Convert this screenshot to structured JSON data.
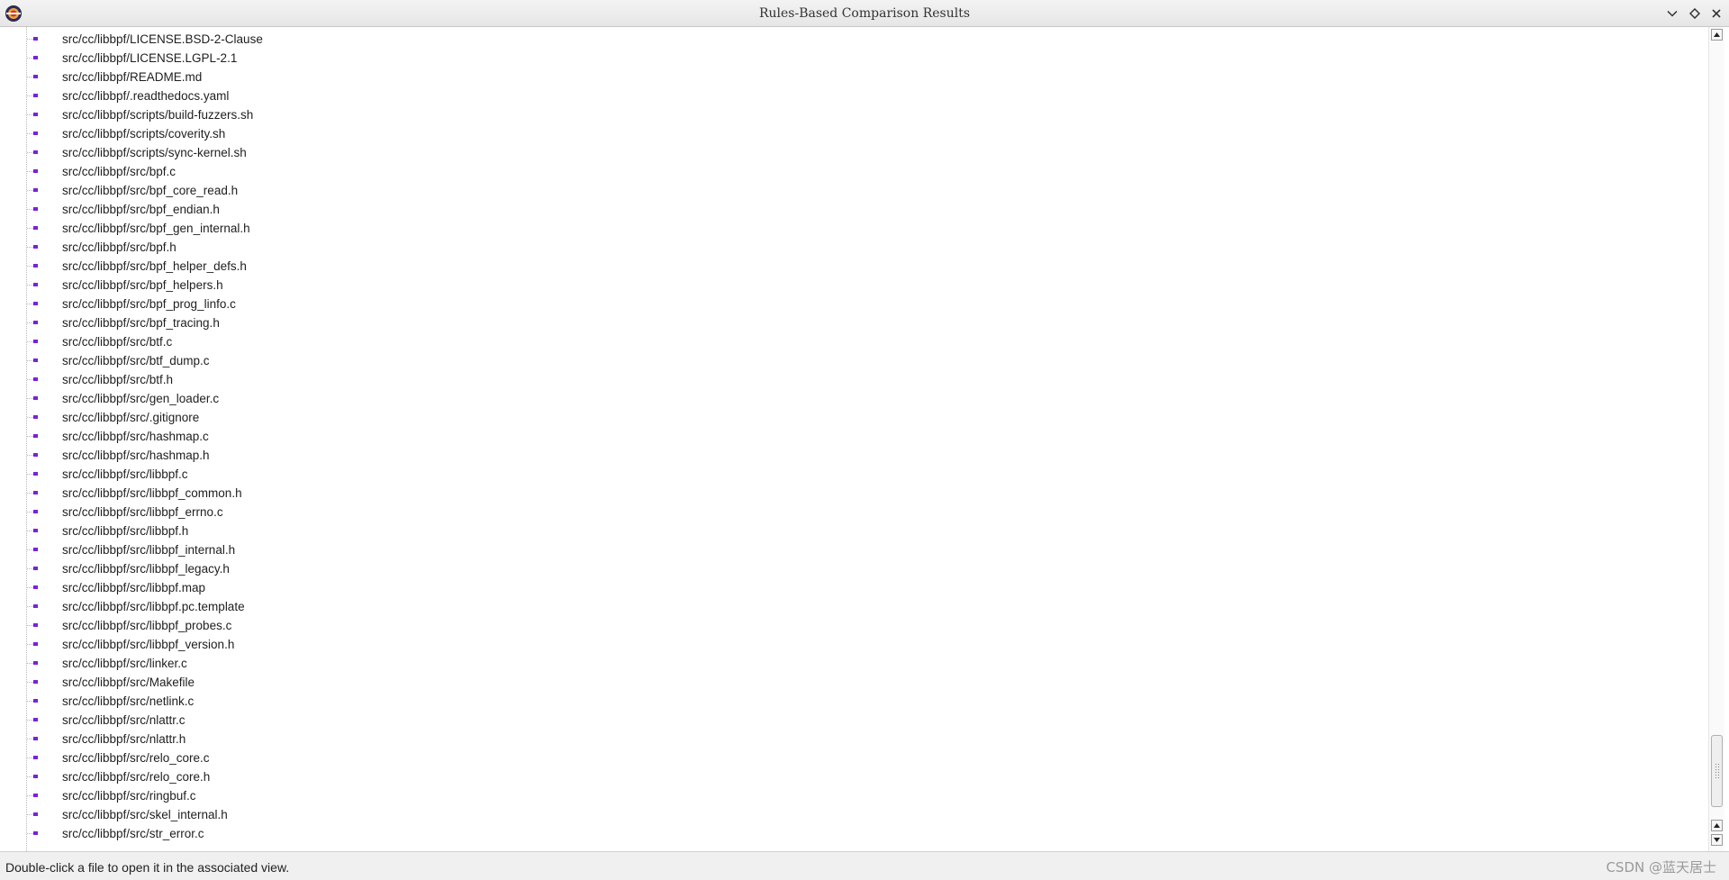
{
  "window": {
    "title": "Rules-Based Comparison Results",
    "icon": "eclipse-app-icon",
    "controls": [
      "chevron-down-icon",
      "restore-icon",
      "close-icon"
    ]
  },
  "files": [
    "src/cc/libbpf/LICENSE.BSD-2-Clause",
    "src/cc/libbpf/LICENSE.LGPL-2.1",
    "src/cc/libbpf/README.md",
    "src/cc/libbpf/.readthedocs.yaml",
    "src/cc/libbpf/scripts/build-fuzzers.sh",
    "src/cc/libbpf/scripts/coverity.sh",
    "src/cc/libbpf/scripts/sync-kernel.sh",
    "src/cc/libbpf/src/bpf.c",
    "src/cc/libbpf/src/bpf_core_read.h",
    "src/cc/libbpf/src/bpf_endian.h",
    "src/cc/libbpf/src/bpf_gen_internal.h",
    "src/cc/libbpf/src/bpf.h",
    "src/cc/libbpf/src/bpf_helper_defs.h",
    "src/cc/libbpf/src/bpf_helpers.h",
    "src/cc/libbpf/src/bpf_prog_linfo.c",
    "src/cc/libbpf/src/bpf_tracing.h",
    "src/cc/libbpf/src/btf.c",
    "src/cc/libbpf/src/btf_dump.c",
    "src/cc/libbpf/src/btf.h",
    "src/cc/libbpf/src/gen_loader.c",
    "src/cc/libbpf/src/.gitignore",
    "src/cc/libbpf/src/hashmap.c",
    "src/cc/libbpf/src/hashmap.h",
    "src/cc/libbpf/src/libbpf.c",
    "src/cc/libbpf/src/libbpf_common.h",
    "src/cc/libbpf/src/libbpf_errno.c",
    "src/cc/libbpf/src/libbpf.h",
    "src/cc/libbpf/src/libbpf_internal.h",
    "src/cc/libbpf/src/libbpf_legacy.h",
    "src/cc/libbpf/src/libbpf.map",
    "src/cc/libbpf/src/libbpf.pc.template",
    "src/cc/libbpf/src/libbpf_probes.c",
    "src/cc/libbpf/src/libbpf_version.h",
    "src/cc/libbpf/src/linker.c",
    "src/cc/libbpf/src/Makefile",
    "src/cc/libbpf/src/netlink.c",
    "src/cc/libbpf/src/nlattr.c",
    "src/cc/libbpf/src/nlattr.h",
    "src/cc/libbpf/src/relo_core.c",
    "src/cc/libbpf/src/relo_core.h",
    "src/cc/libbpf/src/ringbuf.c",
    "src/cc/libbpf/src/skel_internal.h",
    "src/cc/libbpf/src/str_error.c"
  ],
  "status": {
    "message": "Double-click a file to open it in the associated view."
  },
  "watermark": "CSDN @蓝天居士",
  "colors": {
    "file_icon": "#7a22d6",
    "titlebar": "#e9e9e9"
  }
}
